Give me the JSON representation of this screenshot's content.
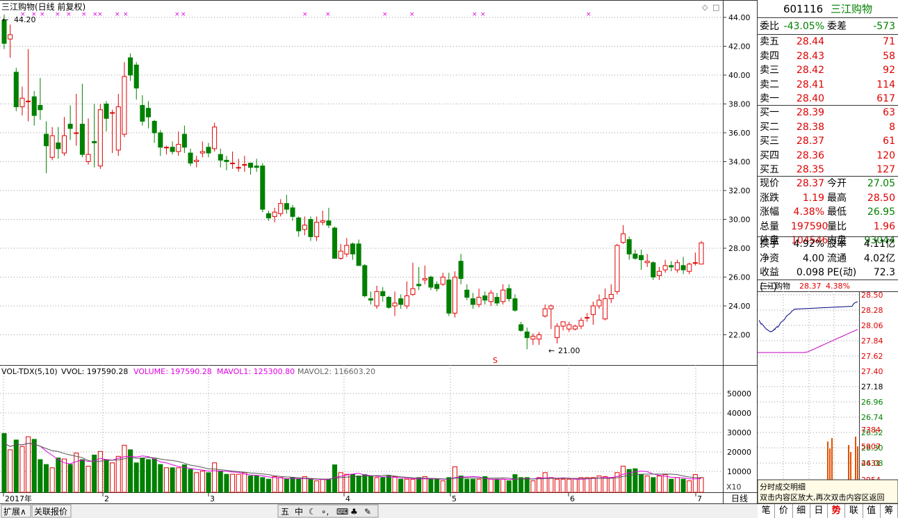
{
  "chart_title": "三江购物(日线 前复权)",
  "hi_label": "44.20",
  "lo_label": "21.00",
  "s_marker": "S",
  "price_axis": [
    "44.00",
    "42.00",
    "40.00",
    "38.00",
    "36.00",
    "34.00",
    "32.00",
    "30.00",
    "28.00",
    "26.00",
    "24.00",
    "22.00"
  ],
  "vol_axis": [
    "50000",
    "40000",
    "30000",
    "20000",
    "10000"
  ],
  "vol_unit": "X10",
  "vol_title": {
    "name": "VOL-TDX(5,10)",
    "vvol": "VVOL: 197590.28",
    "volume": "VOLUME: 197590.28",
    "mavol1": "MAVOL1: 125300.80",
    "mavol2": "MAVOL2: 116603.20"
  },
  "date_axis": [
    "2017年",
    "2",
    "3",
    "4",
    "5",
    "6",
    "7"
  ],
  "period_label": "日线",
  "bottom_tabs": [
    "扩展∧",
    "关联报价"
  ],
  "toolbar_icons": [
    "五",
    "中",
    "☾",
    "∘,",
    "⌨",
    "♣",
    "✎"
  ],
  "quote": {
    "code": "601116",
    "name": "三江购物",
    "wei_bi_label": "委比",
    "wei_bi": "-43.05%",
    "wei_cha_label": "委差",
    "wei_cha": "-573",
    "sell": [
      {
        "l": "卖五",
        "p": "28.44",
        "v": "71"
      },
      {
        "l": "卖四",
        "p": "28.43",
        "v": "58"
      },
      {
        "l": "卖三",
        "p": "28.42",
        "v": "92"
      },
      {
        "l": "卖二",
        "p": "28.41",
        "v": "114"
      },
      {
        "l": "卖一",
        "p": "28.40",
        "v": "617"
      }
    ],
    "buy": [
      {
        "l": "买一",
        "p": "28.39",
        "v": "63"
      },
      {
        "l": "买二",
        "p": "28.38",
        "v": "8"
      },
      {
        "l": "买三",
        "p": "28.37",
        "v": "61"
      },
      {
        "l": "买四",
        "p": "28.36",
        "v": "120"
      },
      {
        "l": "买五",
        "p": "28.35",
        "v": "127"
      }
    ],
    "stats1": [
      {
        "l": "现价",
        "v": "28.37",
        "l2": "今开",
        "v2": "27.05"
      },
      {
        "l": "涨跌",
        "v": "1.19",
        "l2": "最高",
        "v2": "28.50"
      },
      {
        "l": "涨幅",
        "v": "4.38%",
        "l2": "最低",
        "v2": "26.95"
      },
      {
        "l": "总量",
        "v": "197590",
        "l2": "量比",
        "v2": "1.96"
      },
      {
        "l": "外盘",
        "v": "104546",
        "l2": "内盘",
        "v2": "93044"
      }
    ],
    "stats2": [
      {
        "l": "换手",
        "v": "4.92%",
        "l2": "股本",
        "v2": "4.11亿"
      },
      {
        "l": "净资",
        "v": "4.00",
        "l2": "流通",
        "v2": "4.02亿"
      },
      {
        "l": "收益(一)",
        "v": "0.098",
        "l2": "PE(动)",
        "v2": "72.3"
      }
    ]
  },
  "mini": {
    "title": "三江购物",
    "price": "28.37",
    "pct": "4.38%",
    "axis_top": [
      "28.50",
      "28.28",
      "28.06",
      "27.84",
      "27.62",
      "27.40",
      "27.18",
      "26.96",
      "26.74",
      "26.52",
      "26.30",
      "26.08"
    ],
    "axis_vol": [
      "7384",
      "5907",
      "4431",
      "2954"
    ],
    "panel_title": "分时成交明细",
    "panel_hint": "双击内容区放大,再次双击内容区返回"
  },
  "right_tabs": [
    "笔",
    "价",
    "细",
    "日",
    "势",
    "联",
    "值",
    "筹"
  ],
  "active_tab": "势",
  "chart_data": [
    {
      "type": "candlestick",
      "title": "三江购物(日线 前复权)",
      "ylim": [
        21,
        44.2
      ],
      "high": 44.2,
      "low": 21.0
    },
    {
      "type": "bar",
      "title": "VOL-TDX(5,10)",
      "ylim": [
        0,
        55000
      ]
    }
  ]
}
